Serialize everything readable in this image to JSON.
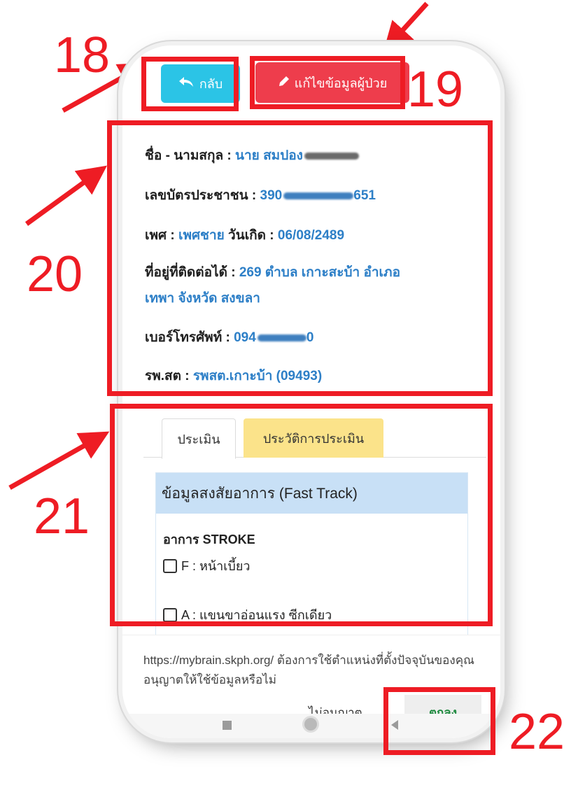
{
  "buttons": {
    "back_label": "กลับ",
    "edit_label": "แก้ไขข้อมูลผู้ป่วย"
  },
  "patient": {
    "name_label": "ชื่อ - นามสกุล :",
    "name_value": "นาย สมปอง",
    "id_label": "เลขบัตรประชาชน :",
    "id_value_start": "390",
    "id_value_end": "651",
    "gender_label": "เพศ :",
    "gender_value": "เพศชาย",
    "birth_label": "วันเกิด :",
    "birth_value": "06/08/2489",
    "address_label": "ที่อยู่ที่ติดต่อได้ :",
    "address_line1": "269 ตำบล เกาะสะบ้า อำเภอ",
    "address_line2": "เทพา จังหวัด สงขลา",
    "phone_label": "เบอร์โทรศัพท์ :",
    "phone_value_start": "094",
    "phone_value_end": "0",
    "hospital_label": "รพ.สต :",
    "hospital_value": "รพสต.เกาะบ้า (09493)"
  },
  "tabs": [
    "ประเมิน",
    "ประวัติการประเมิน"
  ],
  "assessment": {
    "panel_title": "ข้อมูลสงสัยอาการ (Fast Track)",
    "stroke_title": "อาการ STROKE",
    "items": [
      "F : หน้าเบี้ยว",
      "A : แขนขาอ่อนแรง ซีกเดียว"
    ]
  },
  "permission": {
    "text": "https://mybrain.skph.org/ ต้องการใช้ตำแหน่งที่ตั้งปัจจุบันของคุณ อนุญาตให้ใช้ข้อมูลหรือไม่",
    "deny_label": "ไม่อนุญาต",
    "ok_label": "ตกลง"
  },
  "callouts": [
    "18",
    "19",
    "20",
    "21",
    "22"
  ],
  "colors": {
    "annotation": "#ee1c24",
    "back_button": "#2bc4e6",
    "edit_button": "#ee3d4c",
    "value_text": "#2d7fc7",
    "tab_active_bg": "#fbe38a",
    "panel_header": "#c8e0f6",
    "ok_text": "#1e8a3f"
  }
}
